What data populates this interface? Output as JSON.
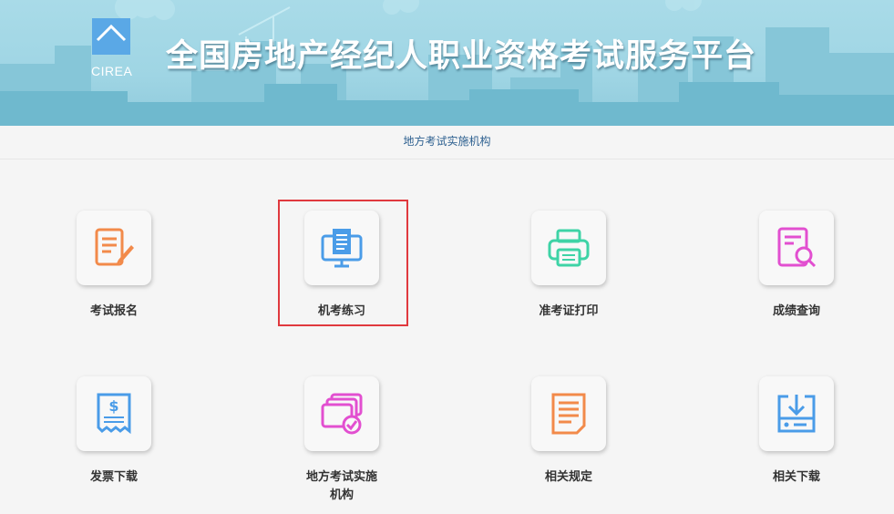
{
  "header": {
    "logo_text": "CIREA",
    "title": "全国房地产经纪人职业资格考试服务平台"
  },
  "subnav": {
    "link": "地方考试实施机构"
  },
  "tiles": [
    {
      "label": "考试报名",
      "icon": "form-edit-icon",
      "color": "#f28a4a"
    },
    {
      "label": "机考练习",
      "icon": "computer-document-icon",
      "color": "#4a9ce8"
    },
    {
      "label": "准考证打印",
      "icon": "printer-icon",
      "color": "#3ed3a6"
    },
    {
      "label": "成绩查询",
      "icon": "document-search-icon",
      "color": "#e24fd0"
    },
    {
      "label": "发票下载",
      "icon": "receipt-icon",
      "color": "#4a9ce8"
    },
    {
      "label": "地方考试实施机构",
      "icon": "cards-check-icon",
      "color": "#e24fd0"
    },
    {
      "label": "相关规定",
      "icon": "document-list-icon",
      "color": "#f28a4a"
    },
    {
      "label": "相关下载",
      "icon": "download-tray-icon",
      "color": "#4a9ce8"
    }
  ],
  "highlighted_tile": "机考练习"
}
